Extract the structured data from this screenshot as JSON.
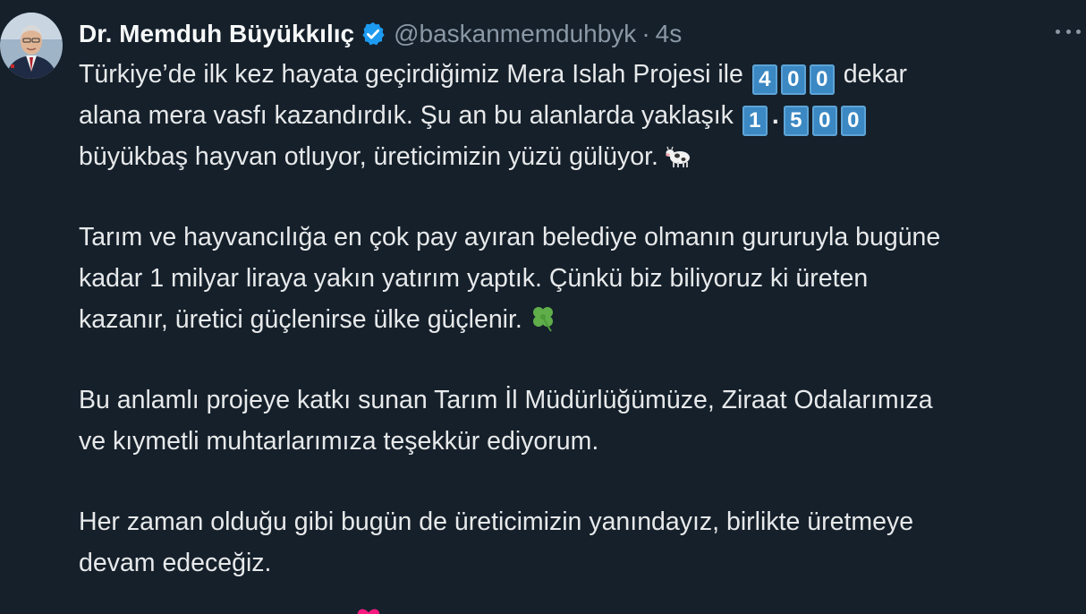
{
  "tweet": {
    "author_name": "Dr. Memduh Büyükkılıç",
    "handle": "@baskanmemduhbyk",
    "separator": "·",
    "time": "4s",
    "verified_color": "#1d9bf0",
    "icons": [
      "verified-badge-icon",
      "more-options-icon",
      "cow-icon",
      "four-leaf-clover-icon",
      "heart-icon"
    ],
    "body": {
      "p1_l1_a": "Türkiye’de ilk kez hayata geçirdiğimiz Mera Islah Projesi ile ",
      "k400": [
        "4",
        "0",
        "0"
      ],
      "p1_l1_b": " dekar",
      "p1_l2_a": "alana mera vasfı kazandırdık. Şu an bu alanlarda yaklaşık ",
      "k1500_a": "1",
      "k1500_dot": ".",
      "k1500_b": [
        "5",
        "0",
        "0"
      ],
      "p1_l3": "büyükbaş hayvan otluyor, üreticimizin yüzü gülüyor.",
      "p2_l1": "Tarım ve hayvancılığa en çok pay ayıran belediye olmanın gururuyla bugüne",
      "p2_l2": "kadar 1 milyar liraya yakın yatırım yaptık. Çünkü biz biliyoruz ki üreten",
      "p2_l3": "kazanır, üretici güçlenirse ülke güçlenir.",
      "p3_l1": "Bu anlamlı projeye katkı sunan Tarım İl Müdürlüğümüze, Ziraat Odalarımıza",
      "p3_l2": "ve kıymetli muhtarlarımıza teşekkür ediyorum.",
      "p4_l1": "Her zaman olduğu gibi bugün de üreticimizin yanındayız, birlikte üretmeye",
      "p4_l2": "devam edeceğiz."
    }
  },
  "colors": {
    "background": "#15202b",
    "text": "#e7e9ea",
    "secondary_text": "#8b98a5",
    "keycap": "#3b88c3"
  }
}
